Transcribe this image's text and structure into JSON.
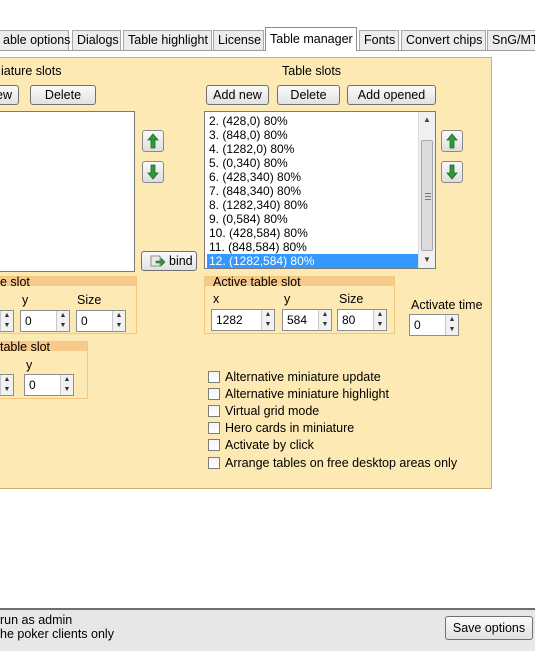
{
  "tabs": [
    {
      "label": "able options",
      "active": false
    },
    {
      "label": "Dialogs",
      "active": false
    },
    {
      "label": "Table highlight",
      "active": false
    },
    {
      "label": "License",
      "active": false
    },
    {
      "label": "Table manager",
      "active": true
    },
    {
      "label": "Fonts",
      "active": false
    },
    {
      "label": "Convert chips",
      "active": false
    },
    {
      "label": "SnG/MT",
      "active": false
    }
  ],
  "miniature": {
    "header": "iature slots",
    "new_label": "ew",
    "delete_label": "Delete",
    "bind_label": "bind"
  },
  "table_slots": {
    "header": "Table slots",
    "add_new_label": "Add new",
    "delete_label": "Delete",
    "add_opened_label": "Add opened",
    "items": [
      "2. (428,0) 80%",
      "3. (848,0) 80%",
      "4. (1282,0) 80%",
      "5. (0,340) 80%",
      "6. (428,340) 80%",
      "7. (848,340) 80%",
      "8. (1282,340) 80%",
      "9. (0,584) 80%",
      "10. (428,584) 80%",
      "11. (848,584) 80%",
      "12. (1282,584) 80%"
    ],
    "selected_index": 10
  },
  "left_slot": {
    "title": "e slot",
    "y_label": "y",
    "size_label": "Size",
    "x_value": "",
    "y_value": "0",
    "size_value": "0"
  },
  "left_table_slot": {
    "title": "table slot",
    "y_label": "y",
    "y_value": "0"
  },
  "active_table_slot": {
    "title": "Active table slot",
    "x_label": "x",
    "y_label": "y",
    "size_label": "Size",
    "x_value": "1282",
    "y_value": "584",
    "size_value": "80"
  },
  "activate_time": {
    "label": "Activate time",
    "value": "0"
  },
  "options": [
    {
      "label": "Alternative miniature update",
      "checked": false
    },
    {
      "label": "Alternative miniature highlight",
      "checked": false
    },
    {
      "label": "Virtual grid mode",
      "checked": false
    },
    {
      "label": "Hero cards in miniature",
      "checked": false
    },
    {
      "label": "Activate by click",
      "checked": false
    },
    {
      "label": "Arrange tables on free desktop areas only",
      "checked": false
    }
  ],
  "status": {
    "line1": "run as admin",
    "line2": "he poker clients only",
    "save_label": "Save options"
  },
  "colors": {
    "panel": "#fde9b3",
    "group_header": "#f7c98a",
    "selection": "#3399ff",
    "arrow_green": "#2e9b3a"
  }
}
